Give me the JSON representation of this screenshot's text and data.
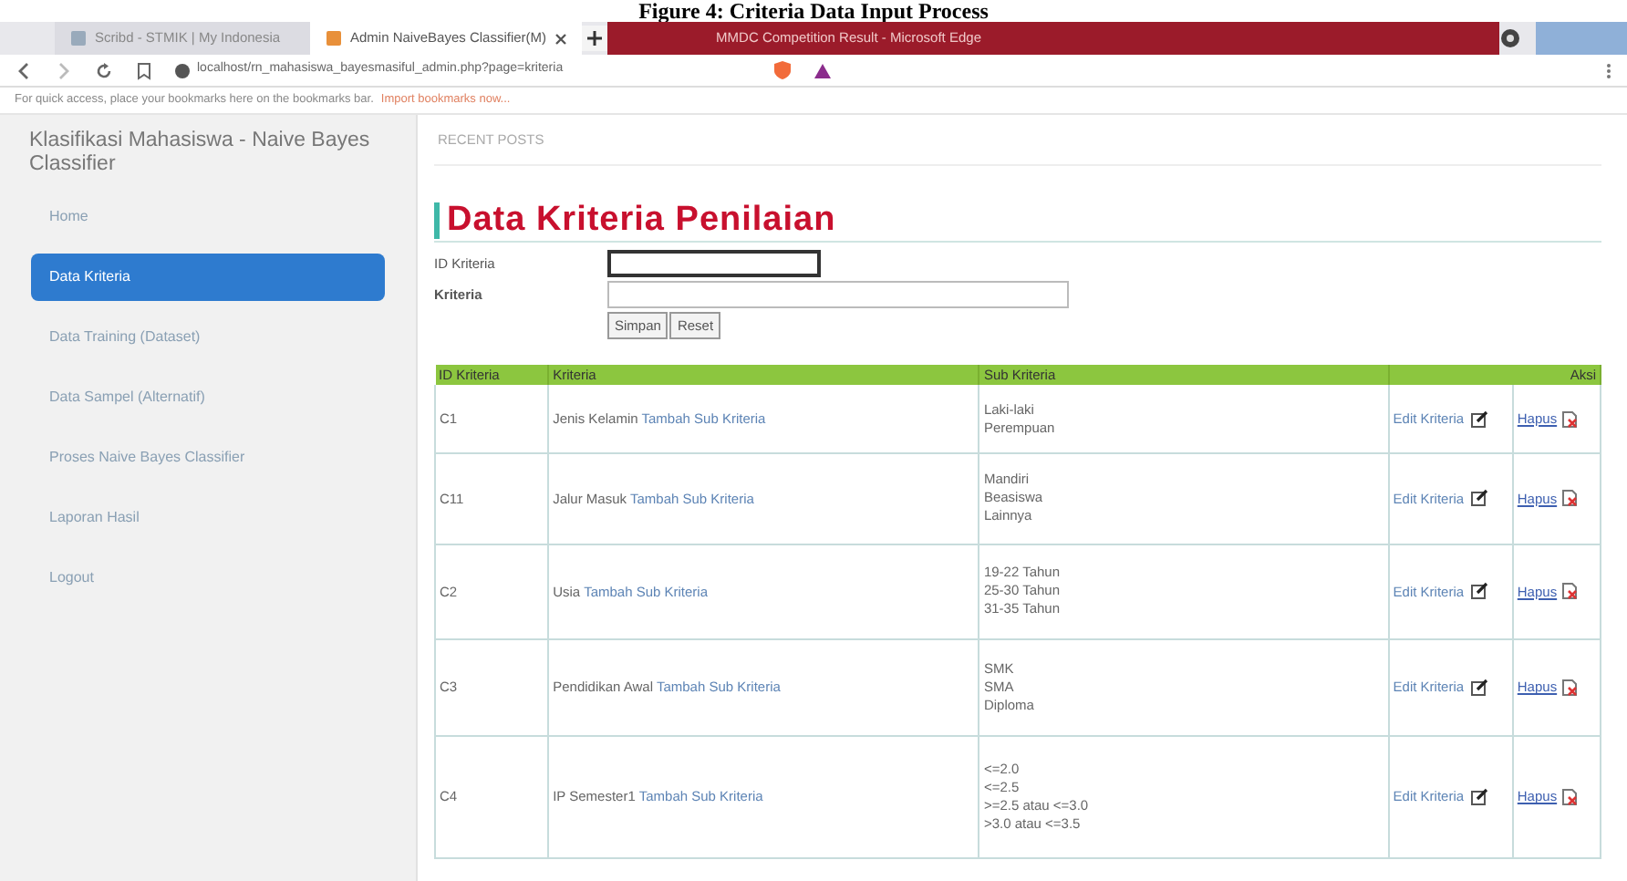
{
  "caption": "Figure 4: Criteria Data Input Process",
  "browser": {
    "tabs": [
      {
        "label": "Scribd - STMIK | My Indonesia",
        "selected": false
      },
      {
        "label": "Admin NaiveBayes Classifier(M)",
        "selected": true
      },
      {
        "label": "MMDC Competition Result - Microsoft Edge",
        "selected": false
      }
    ],
    "url": "localhost/rn_mahasiswa_bayesmasiful_admin.php?page=kriteria",
    "bookmarks_hint": "For quick access, place your bookmarks here on the bookmarks bar.",
    "bookmarks_link": "Import bookmarks now..."
  },
  "app_title": "Klasifikasi Mahasiswa - Naive Bayes Classifier",
  "sidebar": {
    "items": [
      {
        "label": "Home",
        "selected": false
      },
      {
        "label": "Data Kriteria",
        "selected": true
      },
      {
        "label": "Data Training (Dataset)",
        "selected": false
      },
      {
        "label": "Data Sampel (Alternatif)",
        "selected": false
      },
      {
        "label": "Proses Naive Bayes Classifier",
        "selected": false
      },
      {
        "label": "Laporan Hasil",
        "selected": false
      },
      {
        "label": "Logout",
        "selected": false
      }
    ]
  },
  "recent_posts": "RECENT POSTS",
  "heading": "Data Kriteria Penilaian",
  "form": {
    "fields": [
      {
        "label": "ID Kriteria",
        "focused": true
      },
      {
        "label": "Kriteria",
        "focused": false
      }
    ],
    "buttons": [
      "Simpan",
      "Reset"
    ]
  },
  "table": {
    "columns": [
      "ID Kriteria",
      "Kriteria",
      "Sub Kriteria",
      "Aksi"
    ],
    "rows": [
      {
        "id": "C1",
        "name": "Jenis Kelamin",
        "add_link": "Tambah Sub Kriteria",
        "sub": [
          "Laki-laki",
          "Perempuan"
        ],
        "edit_link": "Edit Kriteria",
        "delete_link": "Hapus"
      },
      {
        "id": "C11",
        "name": "Jalur Masuk",
        "add_link": "Tambah Sub Kriteria",
        "sub": [
          "Mandiri",
          "Beasiswa",
          "Lainnya"
        ],
        "edit_link": "Edit Kriteria",
        "delete_link": "Hapus"
      },
      {
        "id": "C2",
        "name": "Usia",
        "add_link": "Tambah Sub Kriteria",
        "sub": [
          "19-22 Tahun",
          "25-30 Tahun",
          "31-35 Tahun"
        ],
        "edit_link": "Edit Kriteria",
        "delete_link": "Hapus"
      },
      {
        "id": "C3",
        "name": "Pendidikan Awal",
        "add_link": "Tambah Sub Kriteria",
        "sub": [
          "SMK",
          "SMA",
          "Diploma"
        ],
        "edit_link": "Edit Kriteria",
        "delete_link": "Hapus"
      },
      {
        "id": "C4",
        "name": "IP Semester1",
        "add_link": "Tambah Sub Kriteria",
        "sub": [
          "<=2.0",
          "<=2.5",
          ">=2.5 atau <=3.0",
          ">3.0 atau <=3.5"
        ],
        "edit_link": "Edit Kriteria",
        "delete_link": "Hapus"
      }
    ]
  }
}
